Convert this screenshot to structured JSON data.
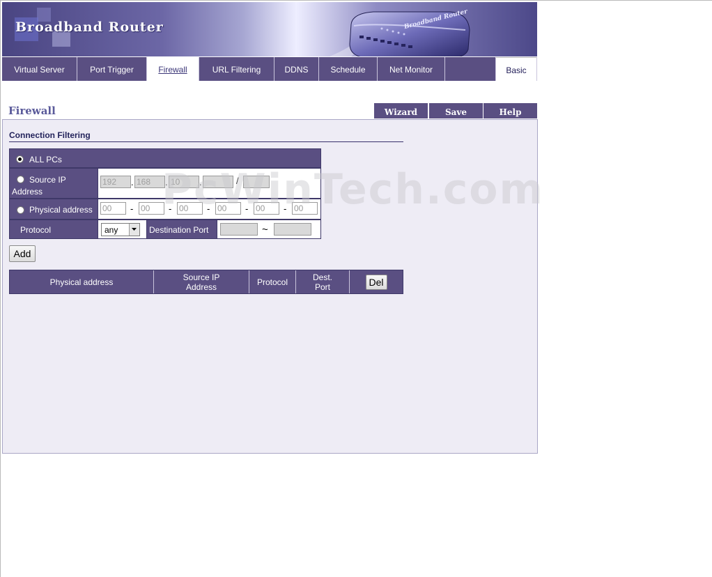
{
  "banner": {
    "brand": "Broadband Router",
    "device_label": "Broadband Router"
  },
  "tabs": [
    {
      "label": "Virtual Server"
    },
    {
      "label": "Port Trigger"
    },
    {
      "label": "Firewall"
    },
    {
      "label": "URL Filtering"
    },
    {
      "label": "DDNS"
    },
    {
      "label": "Schedule"
    },
    {
      "label": "Net Monitor"
    },
    {
      "label": ""
    },
    {
      "label": "Basic"
    }
  ],
  "page": {
    "title": "Firewall"
  },
  "actions": {
    "wizard": "Wizard",
    "save": "Save",
    "help": "Help"
  },
  "connection_filtering": {
    "section_title": "Connection Filtering",
    "all_pcs": {
      "label": "ALL PCs",
      "checked": true
    },
    "source_ip": {
      "label": "Source IP Address",
      "octets": [
        "192",
        "168",
        "10",
        "",
        ""
      ],
      "dot": ".",
      "slash": "/"
    },
    "physical_address": {
      "label": "Physical address",
      "placeholders": [
        "00",
        "00",
        "00",
        "00",
        "00",
        "00"
      ],
      "dash": "-"
    },
    "protocol": {
      "label": "Protocol",
      "selected": "any"
    },
    "destination_port": {
      "label": "Destination Port",
      "from": "",
      "to": "",
      "tilde": "~"
    },
    "add_button": "Add"
  },
  "result_table": {
    "headers": [
      "Physical address",
      "Source IP Address",
      "Protocol",
      "Dest. Port"
    ],
    "del_button": "Del"
  },
  "watermark": "PcWinTech.com",
  "colors": {
    "tab_purple": "#5a4f82",
    "panel_bg": "#eeecf5",
    "title_color": "#5a5a9a"
  }
}
